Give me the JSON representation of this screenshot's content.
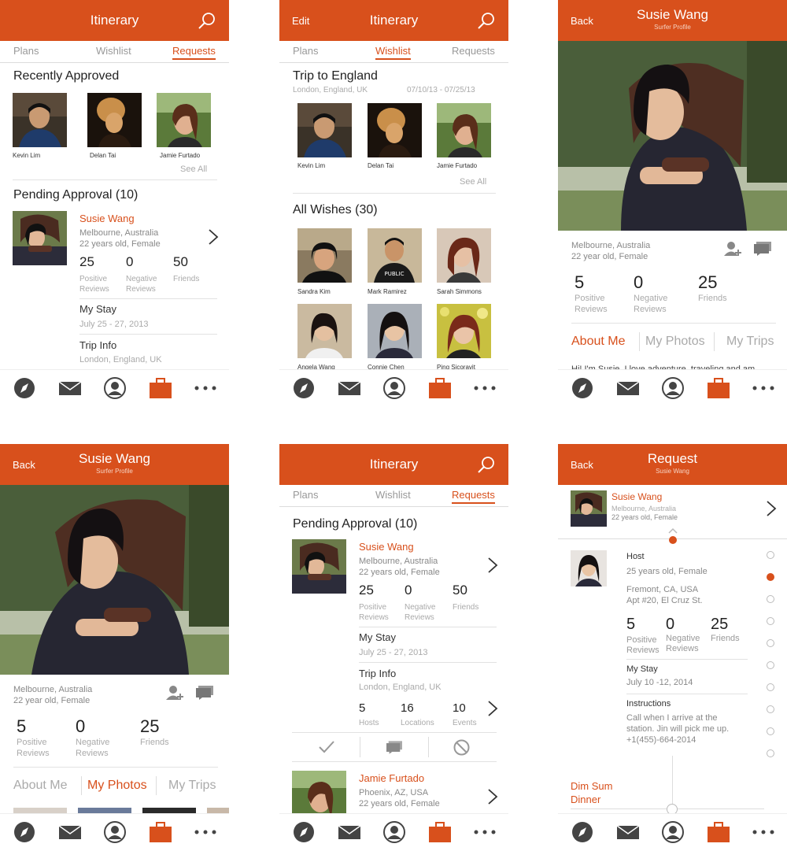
{
  "colors": {
    "accent": "#d8501c"
  },
  "nav_icons": [
    "compass-icon",
    "mail-icon",
    "profile-icon",
    "briefcase-icon",
    "more-icon"
  ],
  "s1": {
    "title": "Itinerary",
    "tabs": [
      "Plans",
      "Wishlist",
      "Requests"
    ],
    "recently_approved": "Recently Approved",
    "approved": [
      {
        "name": "Kevin Lim"
      },
      {
        "name": "Delan Tai"
      },
      {
        "name": "Jamie Furtado"
      }
    ],
    "see_all": "See All",
    "pending": "Pending Approval (10)",
    "person": {
      "name": "Susie Wang",
      "loc": "Melbourne, Australia",
      "age": "22 years old, Female",
      "pos": "25",
      "neg": "0",
      "fr": "50",
      "pos_l1": "Positive",
      "pos_l2": "Reviews",
      "neg_l1": "Negative",
      "neg_l2": "Reviews",
      "fr_l": "Friends"
    },
    "my_stay": "My Stay",
    "stay_dates": "July 25 - 27, 2013",
    "trip_info": "Trip Info",
    "trip_loc": "London, England, UK"
  },
  "s2": {
    "left": "Edit",
    "title": "Itinerary",
    "tabs": [
      "Plans",
      "Wishlist",
      "Requests"
    ],
    "trip": "Trip to England",
    "trip_loc": "London, England, UK",
    "trip_dates": "07/10/13 - 07/25/13",
    "people": [
      {
        "name": "Kevin Lim"
      },
      {
        "name": "Delan Tai"
      },
      {
        "name": "Jamie Furtado"
      }
    ],
    "see_all": "See All",
    "all_wishes": "All Wishes (30)",
    "wishes": [
      {
        "name": "Sandra Kim"
      },
      {
        "name": "Mark Ramirez"
      },
      {
        "name": "Sarah Simmons"
      },
      {
        "name": "Angela Wang"
      },
      {
        "name": "Connie Chen"
      },
      {
        "name": "Ping Sicoravit"
      }
    ],
    "shirt_text": "PUBLIC"
  },
  "s3": {
    "back": "Back",
    "title": "Susie Wang",
    "subtitle": "Surfer Profile",
    "loc": "Melbourne, Australia",
    "age": "22 year old, Female",
    "pos": "5",
    "neg": "0",
    "fr": "25",
    "pos_l1": "Positive",
    "pos_l2": "Reviews",
    "neg_l1": "Negative",
    "neg_l2": "Reviews",
    "fr_l": "Friends",
    "tabs": [
      "About Me",
      "My Photos",
      "My Trips"
    ],
    "about": "Hi! I'm Susie. I love adventure, traveling and am"
  },
  "s4": {
    "back": "Back",
    "title": "Susie Wang",
    "subtitle": "Surfer Profile",
    "loc": "Melbourne, Australia",
    "age": "22 year old, Female",
    "pos": "5",
    "neg": "0",
    "fr": "25",
    "pos_l1": "Positive",
    "pos_l2": "Reviews",
    "neg_l1": "Negative",
    "neg_l2": "Reviews",
    "fr_l": "Friends",
    "tabs": [
      "About Me",
      "My Photos",
      "My Trips"
    ]
  },
  "s5": {
    "title": "Itinerary",
    "tabs": [
      "Plans",
      "Wishlist",
      "Requests"
    ],
    "pending": "Pending Approval (10)",
    "p1": {
      "name": "Susie Wang",
      "loc": "Melbourne, Australia",
      "age": "22 years old, Female",
      "pos": "25",
      "neg": "0",
      "fr": "50",
      "pos_l1": "Positive",
      "pos_l2": "Reviews",
      "neg_l1": "Negative",
      "neg_l2": "Reviews",
      "fr_l": "Friends"
    },
    "my_stay": "My Stay",
    "stay_dates": "July 25 - 27, 2013",
    "trip_info": "Trip Info",
    "trip_loc": "London, England, UK",
    "hosts": "5",
    "locations": "16",
    "events": "10",
    "hosts_l": "Hosts",
    "locations_l": "Locations",
    "events_l": "Events",
    "p2": {
      "name": "Jamie Furtado",
      "loc": "Phoenix, AZ, USA",
      "age": "22 years old, Female"
    }
  },
  "s6": {
    "back": "Back",
    "title": "Request",
    "subtitle": "Susie Wang",
    "name": "Susie Wang",
    "loc": "Melbourne, Australia",
    "age": "22 years old, Female",
    "host": "Host",
    "host_age": "25 years old, Female",
    "addr1": "Fremont, CA, USA",
    "addr2": "Apt #20, El Cruz St.",
    "pos": "5",
    "neg": "0",
    "fr": "25",
    "pos_l1": "Positive",
    "pos_l2": "Reviews",
    "neg_l1": "Negative",
    "neg_l2": "Reviews",
    "fr_l": "Friends",
    "my_stay": "My Stay",
    "stay": "July 10 -12, 2014",
    "instructions": "Instructions",
    "ins1": "Call when I arrive at the",
    "ins2": "station. Jin will pick me up.",
    "ins3": "+1(455)-664-2014",
    "event1": "Dim Sum",
    "event2": "Dinner"
  }
}
